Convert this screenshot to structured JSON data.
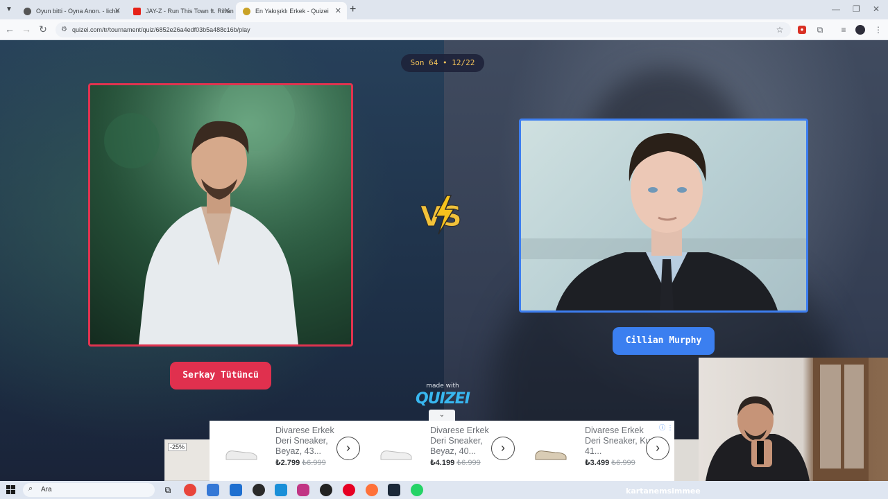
{
  "browser": {
    "tabs": [
      {
        "title": "Oyun bitti - Oyna Anon. - liche",
        "color": "#555555"
      },
      {
        "title": "JAY-Z - Run This Town ft. Rihan",
        "color": "#e62117"
      },
      {
        "title": "En Yakışıklı Erkek - Quizei",
        "color": "#c9a227"
      }
    ],
    "url": "quizei.com/tr/tournament/quiz/6852e26a4edf03b5a488c16b/play"
  },
  "quiz": {
    "round_badge": "Son 64 • 12/22",
    "vs_label": "VS",
    "left_contestant": "Serkay Tütüncü",
    "right_contestant": "Cillian Murphy",
    "made_with": "made with",
    "brand": "QUIZEI",
    "accent_left": "#e0304e",
    "accent_right": "#3b7ff0"
  },
  "ad": {
    "side_discount": "-25%",
    "items": [
      {
        "title": "Divarese Erkek Deri Sneaker, Beyaz, 43...",
        "price": "₺2.799",
        "old_price": "₺6.999"
      },
      {
        "title": "Divarese Erkek Deri Sneaker, Beyaz, 40...",
        "price": "₺4.199",
        "old_price": "₺6.999"
      },
      {
        "title": "Divarese Erkek Deri Sneaker, Kum, 41...",
        "price": "₺3.499",
        "old_price": "₺6.999"
      }
    ]
  },
  "taskbar": {
    "search_placeholder": "Ara",
    "overlay_text": "kartanemsimmee"
  }
}
